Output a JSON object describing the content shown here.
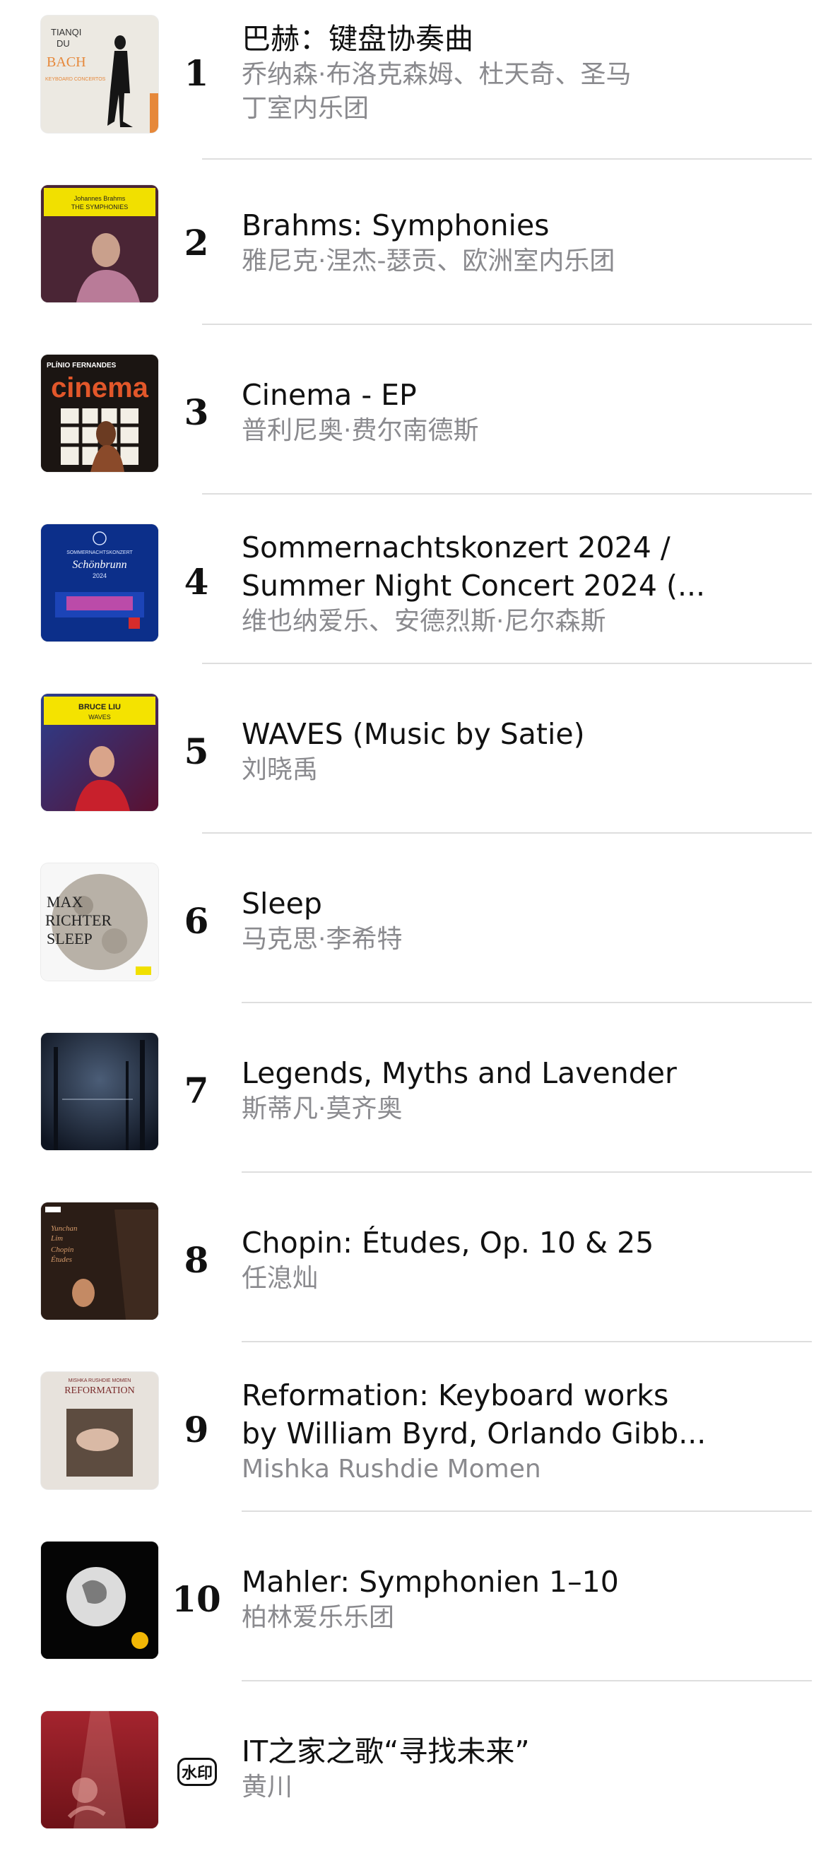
{
  "items": [
    {
      "rank": "1",
      "title": "巴赫：键盘协奏曲",
      "artist_line1": "乔纳森·布洛克森姆、杜天奇、圣马",
      "artist_line2": "丁室内乐团",
      "art": {
        "bg": "#ece9e2",
        "accent": "#e6883a",
        "text1": "TIANQI",
        "text2": "DU",
        "text3": "BACH",
        "text4": "KEYBOARD CONCERTOS"
      }
    },
    {
      "rank": "2",
      "title": "Brahms: Symphonies",
      "artist_line1": "雅尼克·涅杰-瑟贡、欧洲室内乐团",
      "art": {
        "bg": "#4a2535",
        "accent": "#f1e000",
        "text1": "Johannes Brahms",
        "text2": "THE SYMPHONIES"
      }
    },
    {
      "rank": "3",
      "title": "Cinema - EP",
      "artist_line1": "普利尼奥·费尔南德斯",
      "art": {
        "bg": "#1b1512",
        "accent": "#e2572a",
        "text1": "PLÍNIO FERNANDES",
        "text2": "cinema"
      }
    },
    {
      "rank": "4",
      "title_line1": "Sommernachtskonzert 2024 /",
      "title_line2": "Summer Night Concert 2024 (...",
      "artist_line1": "维也纳爱乐、安德烈斯·尼尔森斯",
      "art": {
        "bg": "#0c2f8a",
        "accent": "#ff4fa3",
        "text1": "SOMMERNACHTSKONZERT",
        "text2": "Schönbrunn",
        "text3": "2024"
      }
    },
    {
      "rank": "5",
      "title": "WAVES (Music by Satie)",
      "artist_line1": "刘晓禹",
      "art": {
        "bg": "#1d2e6e",
        "accent": "#f4e300",
        "text1": "BRUCE LIU",
        "text2": "WAVES"
      }
    },
    {
      "rank": "6",
      "title": "Sleep",
      "artist_line1": "马克思·李希特",
      "art": {
        "bg": "#f7f7f7",
        "accent": "#b8b1a7",
        "text1": "MAX",
        "text2": "RICHTER",
        "text3": "SLEEP"
      }
    },
    {
      "rank": "7",
      "title": "Legends, Myths and Lavender",
      "artist_line1": "斯蒂凡·莫齐奥",
      "art": {
        "bg": "#1a2333",
        "accent": "#6d7f96"
      }
    },
    {
      "rank": "8",
      "title": "Chopin: Études, Op. 10 & 25",
      "artist_line1": "任㴧灿",
      "art": {
        "bg": "#2b1d16",
        "accent": "#d49a6a",
        "text1": "Yunchan",
        "text2": "Lim",
        "text3": "Chopin",
        "text4": "Études"
      }
    },
    {
      "rank": "9",
      "title_line1": "Reformation: Keyboard works",
      "title_line2": "by William Byrd, Orlando Gibb...",
      "artist_line1": "Mishka Rushdie Momen",
      "art": {
        "bg": "#e7e2dc",
        "accent": "#7a2d2d",
        "text1": "MISHKA RUSHDIE MOMEN",
        "text2": "REFORMATION"
      }
    },
    {
      "rank": "10",
      "title": "Mahler: Symphonien 1–10",
      "artist_line1": "柏林爱乐乐团",
      "art": {
        "bg": "#050505",
        "accent": "#f2b705"
      }
    },
    {
      "badge": "水印",
      "title": "IT之家之歌“寻找未来”",
      "artist_line1": "黄川",
      "art": {
        "bg": "#8a1a23",
        "accent": "#e8a7a0"
      }
    }
  ]
}
